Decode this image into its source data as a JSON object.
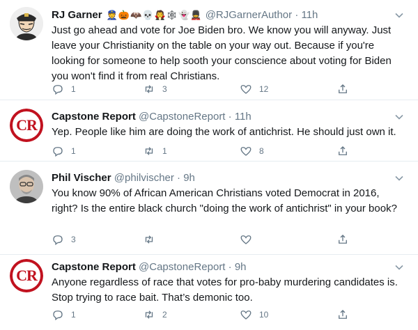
{
  "tweets": [
    {
      "name": "RJ Garner",
      "emoji": "👮🎃🦇💀🧛🕸👻💂",
      "handle": "@RJGarnerAuthor",
      "time": "· 11h",
      "text": "Just go ahead and vote for Joe Biden bro. We know you will anyway. Just leave your Christianity on the table on your way out. Because if you're looking for someone to help sooth your conscience about voting for Biden you won't find it from real Christians.",
      "replies": "1",
      "retweets": "3",
      "likes": "12"
    },
    {
      "name": "Capstone Report",
      "avatar_text": "CR",
      "handle": "@CapstoneReport",
      "time": "· 11h",
      "text": "Yep. People like him are doing the work of antichrist. He should just own it.",
      "replies": "1",
      "retweets": "1",
      "likes": "8"
    },
    {
      "name": "Phil Vischer",
      "handle": "@philvischer",
      "time": "· 9h",
      "text": "You know 90% of African American Christians voted Democrat in 2016, right?  Is the entire black church \"doing the work of antichrist\" in your book?",
      "replies": "3",
      "retweets": "",
      "likes": ""
    },
    {
      "name": "Capstone Report",
      "avatar_text": "CR",
      "handle": "@CapstoneReport",
      "time": "· 9h",
      "text": "Anyone regardless of race that votes for pro-baby murdering candidates is. Stop trying to race bait. That’s demonic too.",
      "replies": "1",
      "retweets": "2",
      "likes": "10"
    }
  ],
  "colors": {
    "text": "#14171a",
    "muted": "#657786",
    "divider": "#e6ecf0",
    "capstone_red": "#c1121f"
  }
}
